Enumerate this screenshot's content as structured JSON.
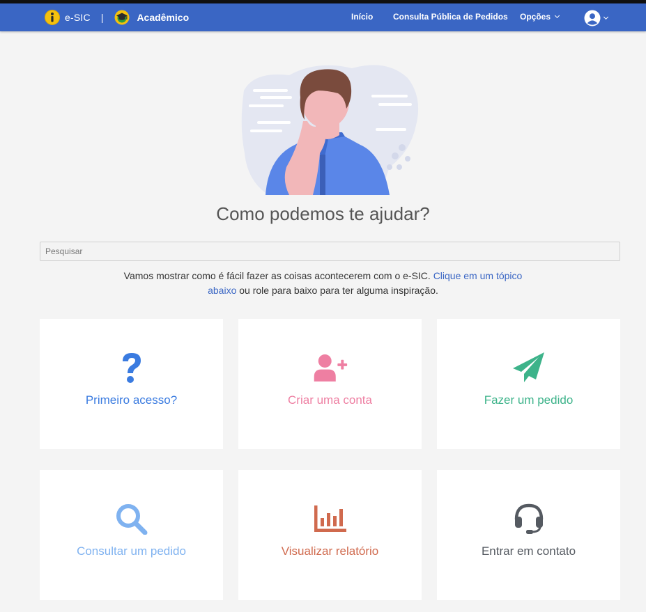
{
  "navbar": {
    "brand_esic": "e-SIC",
    "brand_separator": "|",
    "brand_academico": "Acadêmico",
    "links": {
      "inicio": "Início",
      "consulta": "Consulta Pública de Pedidos",
      "opcoes": "Opções"
    },
    "icons": [
      "info-icon",
      "graduation-cap-icon",
      "user-circle-icon",
      "chevron-down-icon"
    ]
  },
  "hero": {
    "headline": "Como podemos te ajudar?"
  },
  "search": {
    "placeholder": "Pesquisar",
    "value": ""
  },
  "intro": {
    "text_before": "Vamos mostrar como é fácil fazer as coisas acontecerem com o e-SIC. ",
    "link_text": "Clique em um tópico abaixo",
    "text_after": " ou role para baixo para ter alguma inspiração."
  },
  "cards": [
    {
      "label": "Primeiro acesso?",
      "icon": "question-icon",
      "color": "#3a7be0"
    },
    {
      "label": "Criar uma conta",
      "icon": "user-plus-icon",
      "color": "#ee7fa2"
    },
    {
      "label": "Fazer um pedido",
      "icon": "paper-plane-icon",
      "color": "#3db38a"
    },
    {
      "label": "Consultar um pedido",
      "icon": "search-icon",
      "color": "#7fb2f0"
    },
    {
      "label": "Visualizar relatório",
      "icon": "chart-bar-icon",
      "color": "#d06a4e"
    },
    {
      "label": "Entrar em contato",
      "icon": "headset-icon",
      "color": "#555a61"
    }
  ],
  "colors": {
    "navbar": "#3a66c4",
    "background": "#f4f4f4",
    "card": "#ffffff",
    "link": "#3a66c4"
  }
}
